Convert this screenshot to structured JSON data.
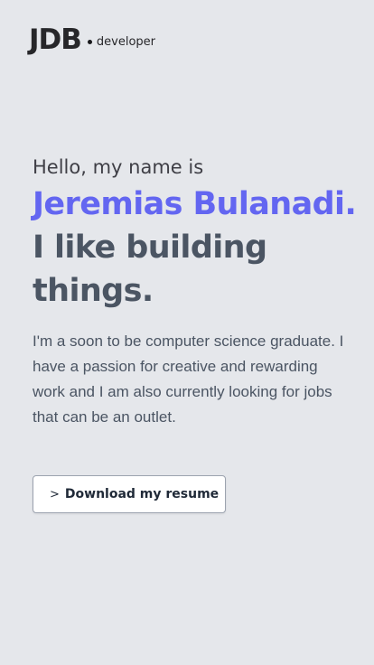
{
  "header": {
    "logo": "JDB",
    "logo_subtitle": "developer"
  },
  "hero": {
    "greeting": "Hello, my name is",
    "name": "Jeremias Bulanadi.",
    "tagline": "I like building things."
  },
  "bio": "I'm a soon to be computer science graduate. I have a passion for creative and rewarding work and I am also currently looking for jobs that can be an outlet.",
  "cta": {
    "prefix": ">",
    "label": "Download my resume"
  },
  "colors": {
    "background": "#e5e7eb",
    "accent": "#6366f1",
    "heading": "#4b5563"
  }
}
